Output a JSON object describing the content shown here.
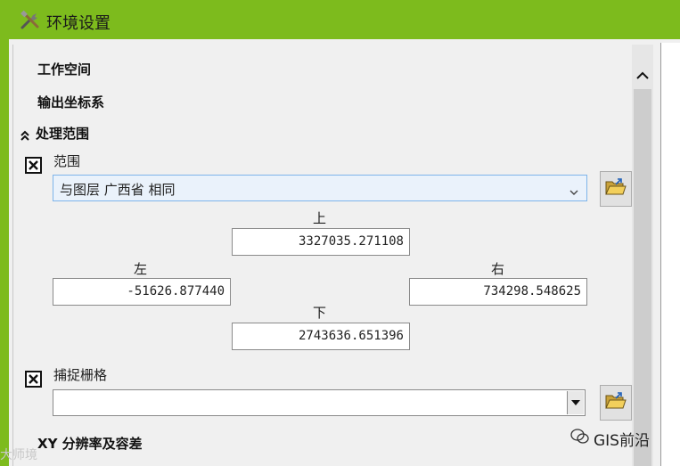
{
  "window": {
    "title": "环境设置"
  },
  "sections": {
    "workspace": "工作空间",
    "output_coords": "输出坐标系",
    "processing_extent": "处理范围",
    "xy_resolution": "XY 分辨率及容差"
  },
  "extent": {
    "label": "范围",
    "selected": "与图层 广西省 相同",
    "top_label": "上",
    "top_value": "3327035.271108",
    "left_label": "左",
    "left_value": "-51626.877440",
    "right_label": "右",
    "right_value": "734298.548625",
    "bottom_label": "下",
    "bottom_value": "2743636.651396"
  },
  "snap_raster": {
    "label": "捕捉栅格",
    "value": ""
  },
  "watermark": {
    "left": "大师境",
    "right": "GIS前沿"
  },
  "colors": {
    "titlebar": "#7dbb1d",
    "select_bg": "#eaf2fb",
    "select_border": "#7eb4ea"
  }
}
